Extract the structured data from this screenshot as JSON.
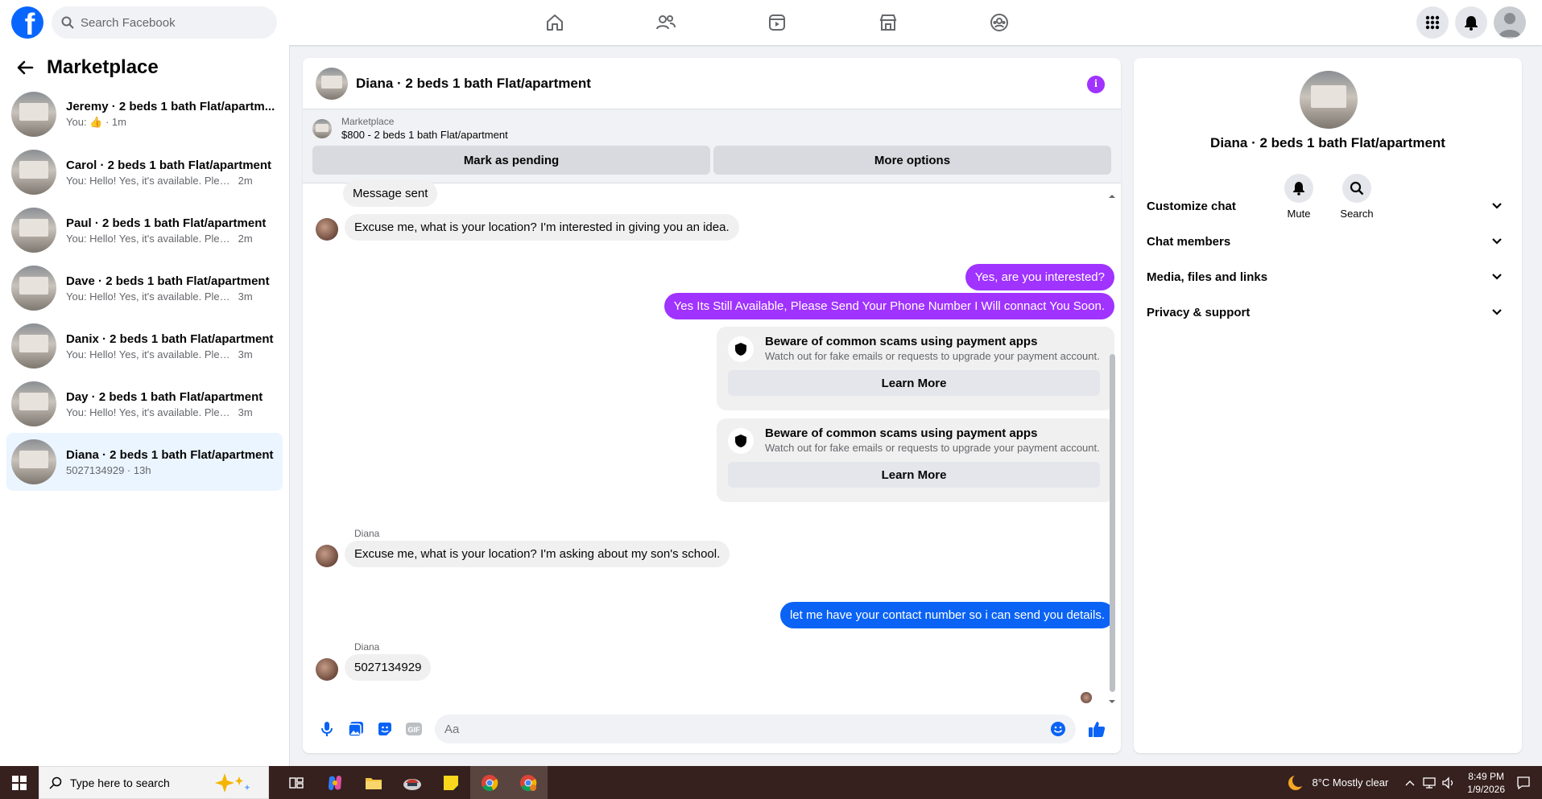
{
  "colors": {
    "facebook_blue": "#0866ff",
    "purple_bubble": "#a033ff",
    "blue_bubble": "#0a63f5",
    "active_conversation": "#ebf5ff"
  },
  "topbar": {
    "logo_glyph": "f",
    "search_placeholder": "Search Facebook",
    "nav_icons": [
      "home-icon",
      "friends-icon",
      "video-icon",
      "marketplace-icon",
      "groups-icon"
    ],
    "right_icons": [
      "menu-grid-icon",
      "bell-icon",
      "account-avatar"
    ]
  },
  "sidebar": {
    "title": "Marketplace",
    "conversations": [
      {
        "title": "Jeremy · 2 beds 1 bath Flat/apartm...",
        "preview": "You: 👍",
        "time": "· 1m"
      },
      {
        "title": "Carol · 2 beds 1 bath Flat/apartment",
        "preview": "You: Hello! Yes, it's available. Please s...",
        "time": "2m"
      },
      {
        "title": "Paul · 2 beds 1 bath Flat/apartment",
        "preview": "You: Hello! Yes, it's available. Please s...",
        "time": "2m"
      },
      {
        "title": "Dave · 2 beds 1 bath Flat/apartment",
        "preview": "You: Hello! Yes, it's available. Please s...",
        "time": "3m"
      },
      {
        "title": "Danix · 2 beds 1 bath Flat/apartment",
        "preview": "You: Hello! Yes, it's available. Please s...",
        "time": "3m"
      },
      {
        "title": "Day · 2 beds 1 bath Flat/apartment",
        "preview": "You: Hello! Yes, it's available. Please s...",
        "time": "3m"
      },
      {
        "title": "Diana · 2 beds 1 bath Flat/apartment",
        "preview": "5027134929 · 13h",
        "time": ""
      }
    ]
  },
  "chat": {
    "title": "Diana · 2 beds 1 bath Flat/apartment",
    "listing": {
      "label": "Marketplace",
      "price_line": "$800 - 2 beds 1 bath Flat/apartment",
      "pending_button": "Mark as pending",
      "options_button": "More options"
    },
    "messages": {
      "m1": "Message sent",
      "m2": "Excuse me, what is your location? I'm interested in giving you an idea.",
      "m3": "Yes, are you interested?",
      "m4": "Yes Its Still Available, Please Send Your Phone Number I Will connact You Soon.",
      "scam_title": "Beware of common scams using payment apps",
      "scam_desc": "Watch out for fake emails or requests to upgrade your payment account.",
      "learn_more": "Learn More",
      "sender1": "Diana",
      "m5": "Excuse me, what is your location? I'm asking about my son's school.",
      "m6": "let me have your contact number so i can send you details.",
      "sender2": "Diana",
      "m7": "5027134929"
    },
    "composer": {
      "placeholder": "Aa",
      "icons": [
        "microphone-icon",
        "photo-icon",
        "sticker-icon",
        "gif-icon",
        "emoji-icon",
        "like-icon"
      ],
      "gif_label": "GIF"
    }
  },
  "details": {
    "title": "Diana · 2 beds 1 bath Flat/apartment",
    "mute_label": "Mute",
    "search_label": "Search",
    "sections": [
      "Customize chat",
      "Chat members",
      "Media, files and links",
      "Privacy & support"
    ]
  },
  "taskbar": {
    "search_placeholder": "Type here to search",
    "weather": "8°C  Mostly clear",
    "time": "8:49 PM",
    "date": "1/9/2026",
    "apps": [
      "task-view-icon",
      "copilot-icon",
      "file-explorer-icon",
      "app-icon",
      "sticky-notes-icon",
      "chrome-icon",
      "chrome-profile-icon"
    ]
  }
}
